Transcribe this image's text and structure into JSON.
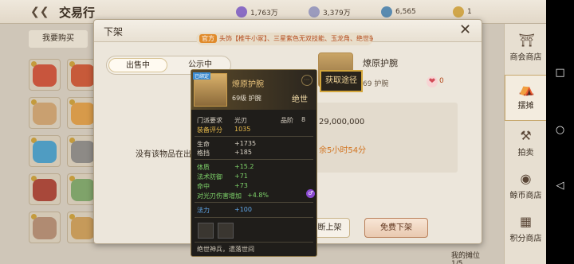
{
  "header": {
    "back_icon": "back-arrow-icon",
    "title": "交易行"
  },
  "currencies": [
    {
      "icon": "purple-gem-icon",
      "color": "#8a6cc4",
      "value": "1,763万"
    },
    {
      "icon": "silver-coin-icon",
      "color": "#9b9bbd",
      "value": "3,379万"
    },
    {
      "icon": "blue-orb-icon",
      "color": "#5a8bb0",
      "value": "6,565"
    },
    {
      "icon": "gold-coin-icon",
      "color": "#d0a64a",
      "value": "1"
    }
  ],
  "market": {
    "buy_header": "我要购买",
    "slot_counts": [
      "1",
      "1",
      "1",
      "1",
      "1",
      "1",
      "1",
      "1",
      "1",
      "1",
      "1",
      "1"
    ]
  },
  "right_nav": [
    {
      "icon": "shop-icon",
      "label": "商会商店"
    },
    {
      "icon": "stall-icon",
      "label": "摆摊"
    },
    {
      "icon": "auction-icon",
      "label": "拍卖"
    },
    {
      "icon": "coin-shop-icon",
      "label": "鲸币商店"
    },
    {
      "icon": "points-shop-icon",
      "label": "积分商店"
    }
  ],
  "android_nav": {
    "square": "□",
    "circle": "○",
    "back": "◁"
  },
  "dialog": {
    "title": "下架",
    "marquee_tag": "官方",
    "marquee_text": "头饰【椎牛小冢】、三星紫色无双技能、玉龙角、绝世装",
    "tabs": [
      "出售中",
      "公示中"
    ],
    "empty_text": "没有该物品在出",
    "item_name": "燎原护腕",
    "item_sub": "69 护腕",
    "fav_count": "0",
    "price": "29,000,000",
    "timer": "余5小时54分",
    "unlist_label": "断上架",
    "free_unlist_label": "免费下架",
    "booth_text": "我的摊位 1/5"
  },
  "tooltip": {
    "bind_tag": "已绑定",
    "name": "燎原护腕",
    "level_slot": "69级  护腕",
    "grade": "绝世",
    "info_icon": "···",
    "rows1": [
      {
        "k": "门派要求",
        "v": "光刃",
        "k2": "品阶",
        "v2": "8"
      },
      {
        "k": "装备评分",
        "v": "1035"
      }
    ],
    "rows2": [
      {
        "k": "生命",
        "v": "+1735"
      },
      {
        "k": "格挡",
        "v": "+185"
      }
    ],
    "rows3": [
      {
        "k": "体质",
        "v": "+15.2"
      },
      {
        "k": "法术防御",
        "v": "+71"
      },
      {
        "k": "命中",
        "v": "+73"
      },
      {
        "k": "对光刃伤害增加",
        "v": "+4.8%"
      }
    ],
    "rows4": [
      {
        "k": "法力",
        "v": "+100"
      }
    ],
    "purple_icon": "♂",
    "footer": "绝世神兵，遗落世间"
  },
  "get_way": "获取途径"
}
